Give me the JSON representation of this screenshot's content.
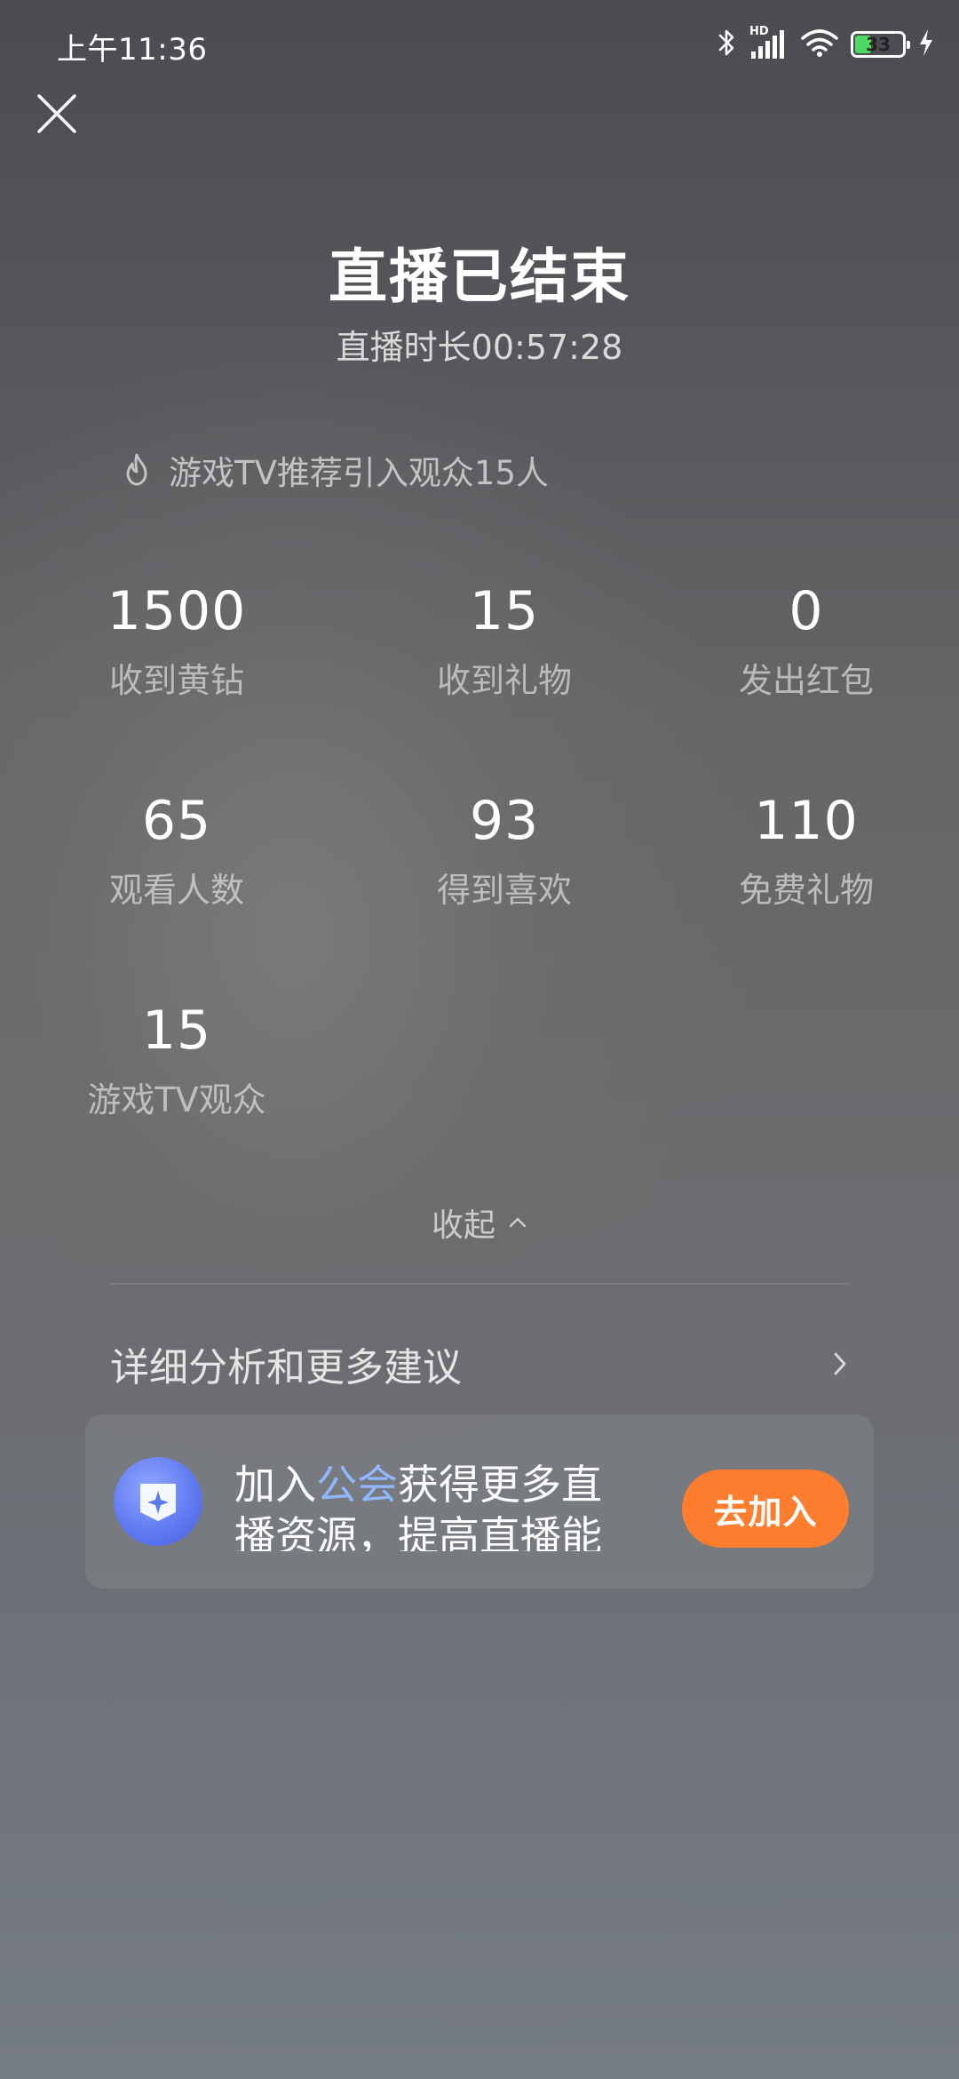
{
  "status_bar": {
    "time": "上午11:36",
    "network_label": "HD",
    "battery_level": "33"
  },
  "header": {
    "title": "直播已结束",
    "duration": "直播时长00:57:28"
  },
  "recommend": {
    "text": "游戏TV推荐引入观众15人"
  },
  "stats": [
    {
      "value": "1500",
      "label": "收到黄钻"
    },
    {
      "value": "15",
      "label": "收到礼物"
    },
    {
      "value": "0",
      "label": "发出红包"
    },
    {
      "value": "65",
      "label": "观看人数"
    },
    {
      "value": "93",
      "label": "得到喜欢"
    },
    {
      "value": "110",
      "label": "免费礼物"
    },
    {
      "value": "15",
      "label": "游戏TV观众"
    }
  ],
  "collapse": {
    "label": "收起"
  },
  "detail": {
    "label": "详细分析和更多建议"
  },
  "guild": {
    "text_before": "加入",
    "text_highlight": "公会",
    "text_after": "获得更多直播资源，提高直播能",
    "button_label": "去加入"
  },
  "colors": {
    "accent_orange": "#ff7d2e",
    "highlight_blue": "#8fb8ff",
    "guild_logo_blue": "#5d78f0",
    "battery_green": "#4cd964"
  }
}
